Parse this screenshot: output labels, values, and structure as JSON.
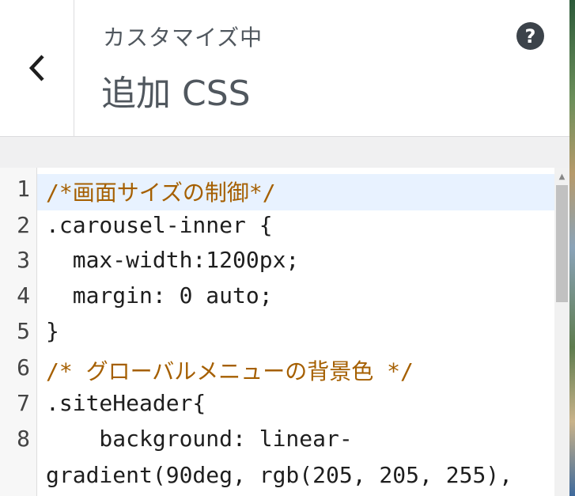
{
  "header": {
    "subtitle": "カスタマイズ中",
    "title": "追加 CSS",
    "back_icon": "chevron-left-icon",
    "help_label": "?"
  },
  "editor": {
    "line_numbers": [
      "1",
      "2",
      "3",
      "4",
      "5",
      "6",
      "7",
      "8"
    ],
    "lines": [
      "/*画面サイズの制御*/",
      ".carousel-inner {",
      "  max-width:1200px;",
      "  margin: 0 auto;",
      "}",
      "/* グローバルメニューの背景色 */",
      ".siteHeader{",
      "    background: linear-",
      "gradient(90deg, rgb(205, 205, 255),"
    ]
  },
  "colors": {
    "comment": "#a55f00",
    "number": "#116644",
    "keyword": "#221199",
    "active_line": "#e8f2ff"
  }
}
